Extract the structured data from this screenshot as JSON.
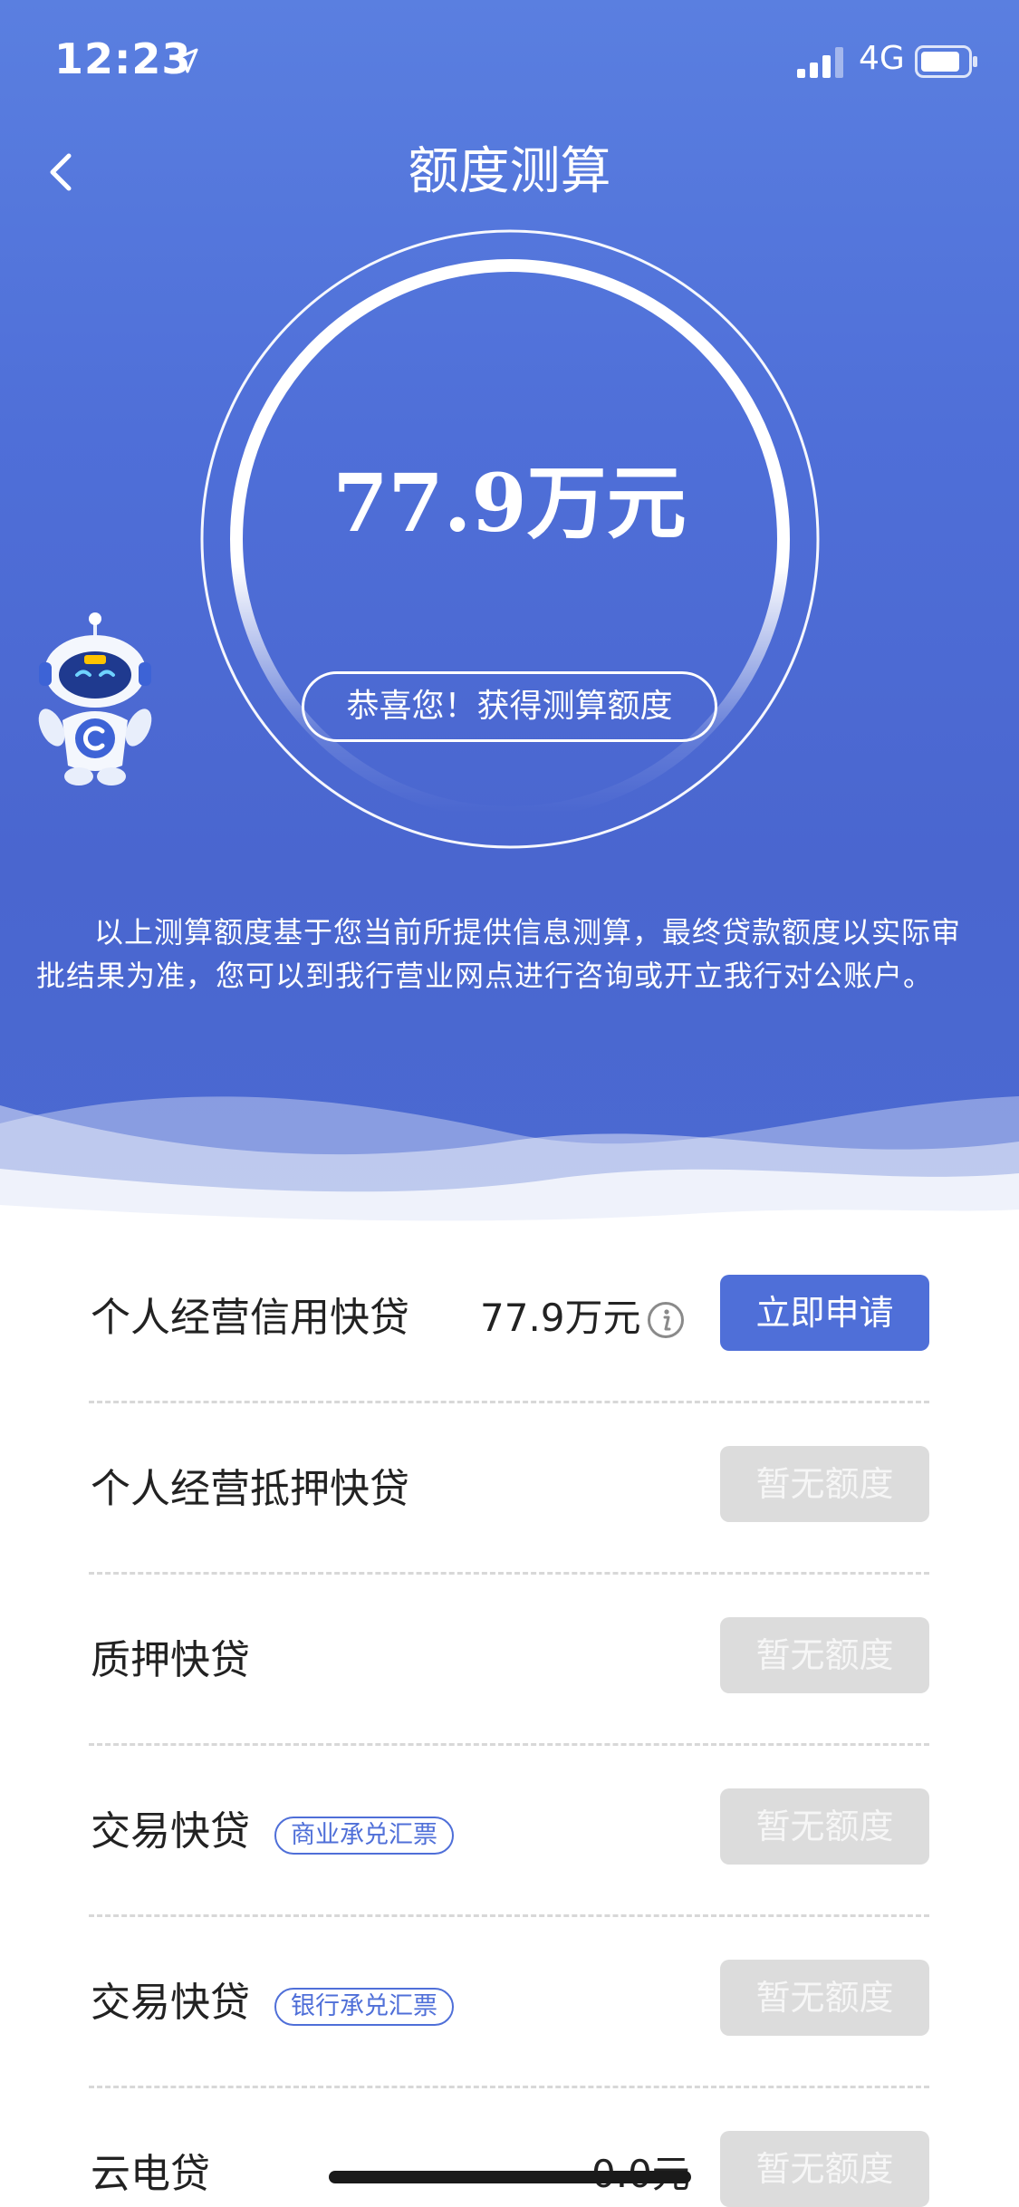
{
  "status_bar": {
    "time": "12:23",
    "network": "4G"
  },
  "nav": {
    "title": "额度测算"
  },
  "estimate": {
    "amount": "77.9万元",
    "congrats": "恭喜您！获得测算额度"
  },
  "notice": "以上测算额度基于您当前所提供信息测算，最终贷款额度以实际审批结果为准，您可以到我行营业网点进行咨询或开立我行对公账户。",
  "products": [
    {
      "name": "个人经营信用快贷",
      "amount": "77.9万元",
      "button": "立即申请",
      "enabled": true
    },
    {
      "name": "个人经营抵押快贷",
      "button": "暂无额度",
      "enabled": false
    },
    {
      "name": "质押快贷",
      "button": "暂无额度",
      "enabled": false
    },
    {
      "name": "交易快贷",
      "tag": "商业承兑汇票",
      "button": "暂无额度",
      "enabled": false
    },
    {
      "name": "交易快贷",
      "tag": "银行承兑汇票",
      "button": "暂无额度",
      "enabled": false
    },
    {
      "name": "云电贷",
      "amount": "0.0元",
      "button": "暂无额度",
      "enabled": false
    }
  ],
  "colors": {
    "primary": "#4f6fd8",
    "hero_top": "#5a7fe0",
    "disabled_button": "#dcdcdc"
  }
}
